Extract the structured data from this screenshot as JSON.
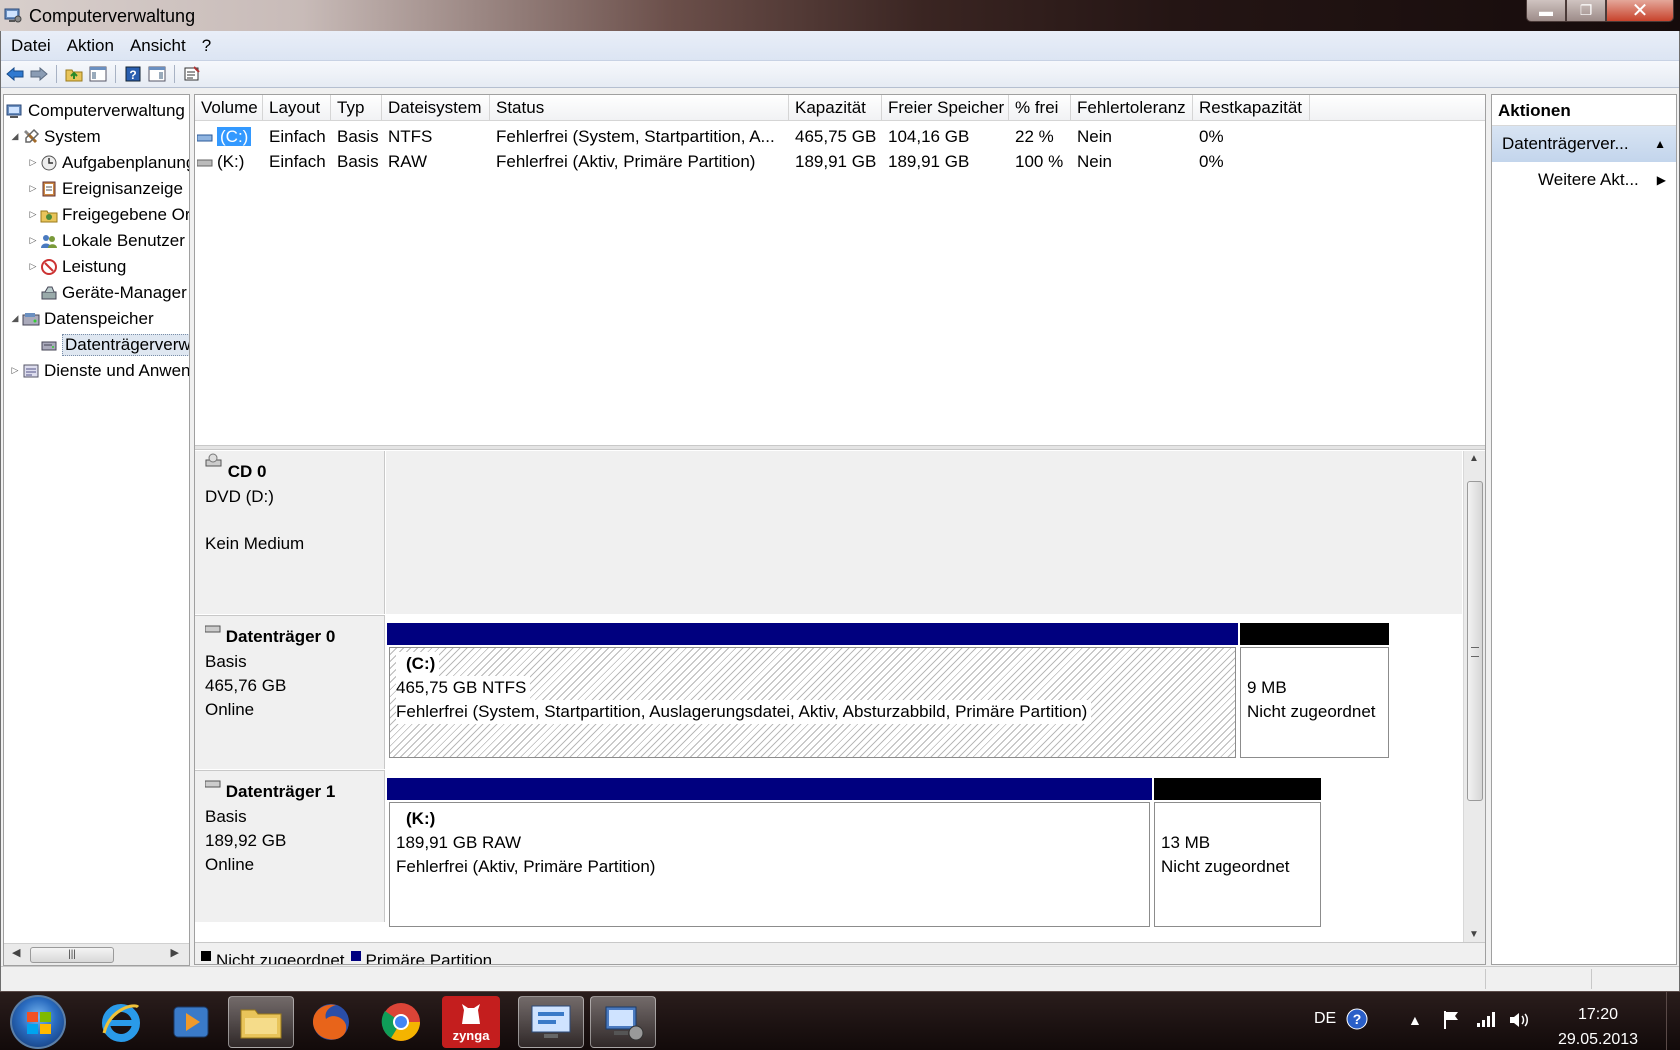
{
  "window": {
    "title": "Computerverwaltung",
    "minimize_glyph": "▬",
    "maximize_glyph": "❐",
    "close_glyph": "✕"
  },
  "menu": [
    "Datei",
    "Aktion",
    "Ansicht",
    "?"
  ],
  "tree": {
    "items": [
      {
        "label": "Computerverwaltung",
        "arrow": "",
        "icon": "computer-icon"
      },
      {
        "label": "System",
        "arrow": "◢",
        "icon": "tools-icon"
      },
      {
        "label": "Aufgabenplanung",
        "arrow": "▷",
        "icon": "clock-icon"
      },
      {
        "label": "Ereignisanzeige",
        "arrow": "▷",
        "icon": "log-icon"
      },
      {
        "label": "Freigegebene Ordner",
        "arrow": "▷",
        "icon": "shared-folder-icon"
      },
      {
        "label": "Lokale Benutzer",
        "arrow": "▷",
        "icon": "users-icon"
      },
      {
        "label": "Leistung",
        "arrow": "▷",
        "icon": "performance-icon"
      },
      {
        "label": "Geräte-Manager",
        "arrow": "",
        "icon": "device-manager-icon"
      },
      {
        "label": "Datenspeicher",
        "arrow": "◢",
        "icon": "storage-icon"
      },
      {
        "label": "Datenträgerverwaltung",
        "arrow": "",
        "icon": "disk-management-icon"
      },
      {
        "label": "Dienste und Anwendungen",
        "arrow": "▷",
        "icon": "services-icon"
      }
    ]
  },
  "volume_table": {
    "columns": [
      "Volume",
      "Layout",
      "Typ",
      "Dateisystem",
      "Status",
      "Kapazität",
      "Freier Speicher",
      "% frei",
      "Fehlertoleranz",
      "Restkapazität"
    ],
    "rows": [
      {
        "volume": "(C:)",
        "layout": "Einfach",
        "typ": "Basis",
        "fs": "NTFS",
        "status": "Fehlerfrei (System, Startpartition, A...",
        "kapazitaet": "465,75 GB",
        "frei": "104,16 GB",
        "prozent": "22 %",
        "fehlertoleranz": "Nein",
        "rest": "0%"
      },
      {
        "volume": "(K:)",
        "layout": "Einfach",
        "typ": "Basis",
        "fs": "RAW",
        "status": "Fehlerfrei (Aktiv, Primäre Partition)",
        "kapazitaet": "189,91 GB",
        "frei": "189,91 GB",
        "prozent": "100 %",
        "fehlertoleranz": "Nein",
        "rest": "0%"
      }
    ]
  },
  "disks": {
    "cd0": {
      "name": "CD 0",
      "line1": "DVD (D:)",
      "line2": "Kein Medium"
    },
    "disk0": {
      "name": "Datenträger 0",
      "type": "Basis",
      "size": "465,76 GB",
      "state": "Online",
      "part1": {
        "name": "(C:)",
        "size": "465,75 GB NTFS",
        "status": "Fehlerfrei (System, Startpartition, Auslagerungsdatei, Aktiv, Absturzabbild, Primäre Partition)"
      },
      "part2": {
        "size": "9 MB",
        "status": "Nicht zugeordnet"
      }
    },
    "disk1": {
      "name": "Datenträger 1",
      "type": "Basis",
      "size": "189,92 GB",
      "state": "Online",
      "part1": {
        "name": "(K:)",
        "size": "189,91 GB RAW",
        "status": "Fehlerfrei (Aktiv, Primäre Partition)"
      },
      "part2": {
        "size": "13 MB",
        "status": "Nicht zugeordnet"
      }
    }
  },
  "legend": [
    {
      "label": "Nicht zugeordnet",
      "color": "#000000"
    },
    {
      "label": "Primäre Partition",
      "color": "#00007f"
    }
  ],
  "actions": {
    "header": "Aktionen",
    "group": "Datenträgerver...",
    "more": "Weitere Akt..."
  },
  "taskbar": {
    "apps": [
      "internet-explorer-icon",
      "media-player-icon",
      "explorer-icon",
      "firefox-icon",
      "chrome-icon",
      "zynga-icon",
      "control-panel-icon",
      "computer-management-icon"
    ],
    "zynga_label": "zynga",
    "lang": "DE",
    "time": "17:20",
    "date": "29.05.2013"
  },
  "colors": {
    "primary_partition": "#00007f",
    "unallocated": "#000000",
    "selection": "#3399ff"
  }
}
